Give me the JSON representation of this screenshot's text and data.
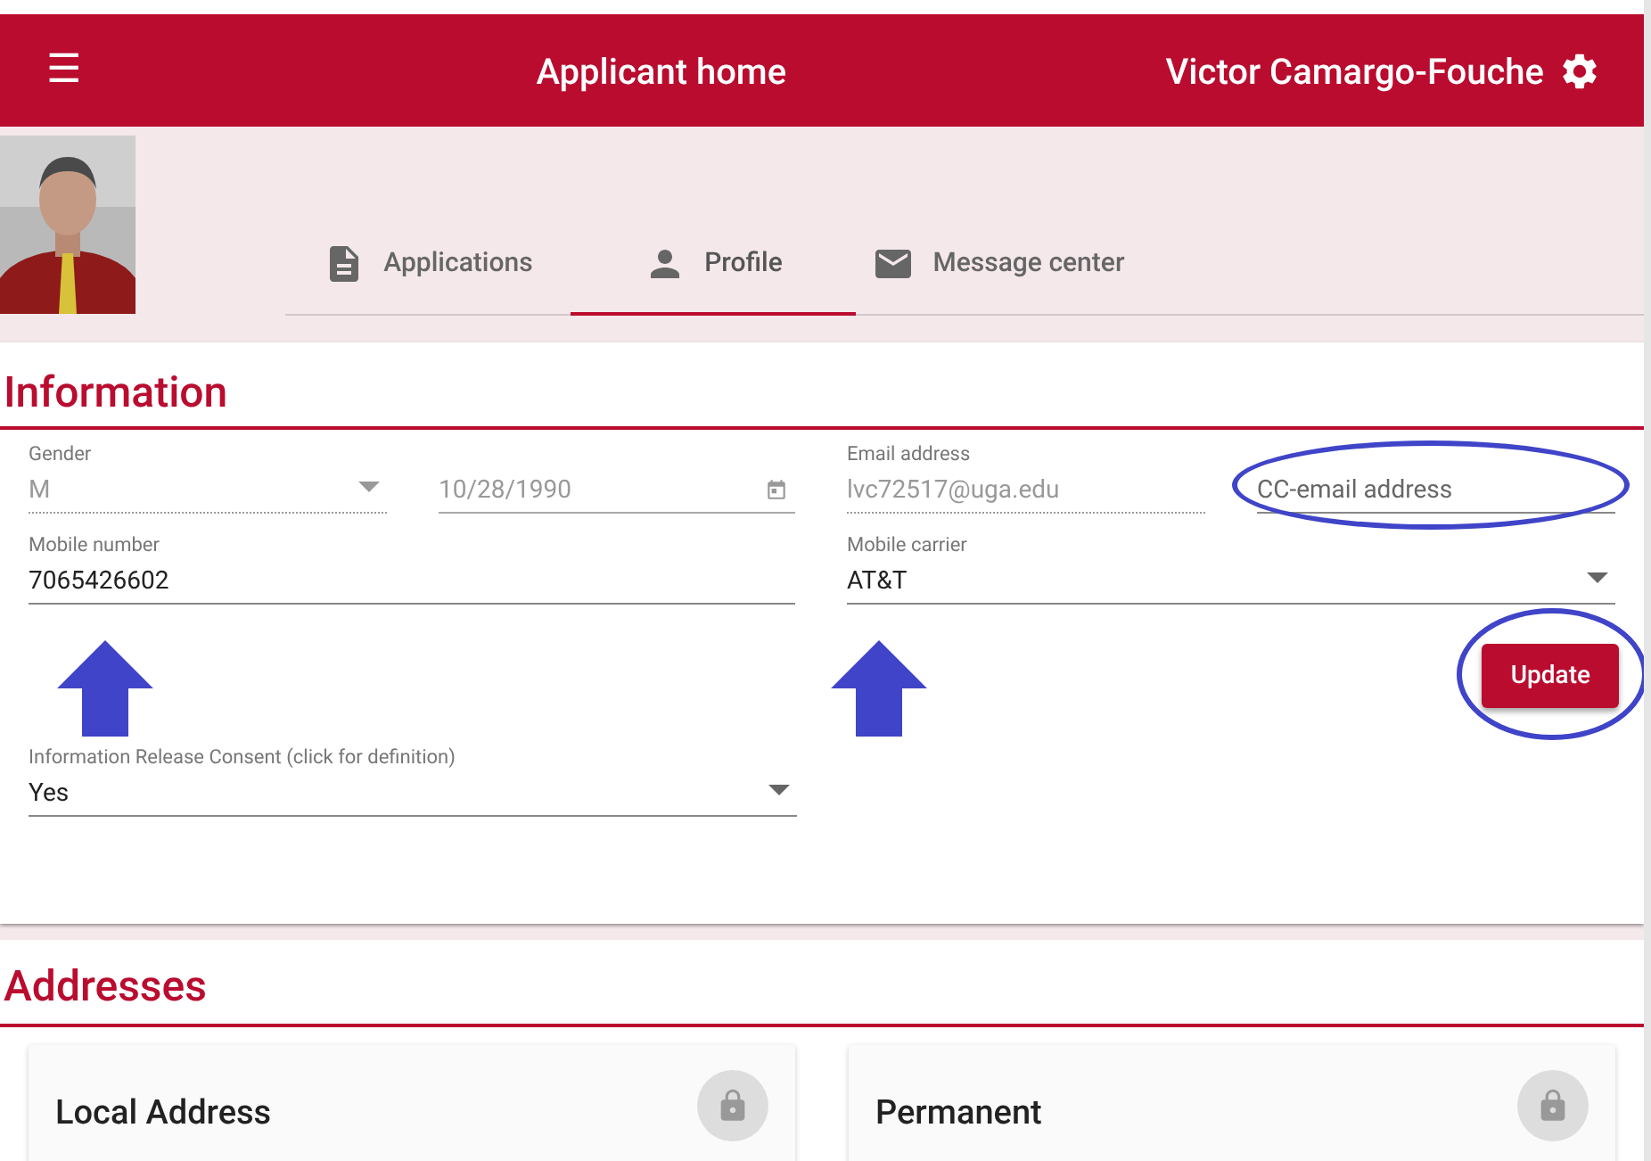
{
  "header": {
    "menu_icon": "☰",
    "title": "Applicant home",
    "user_name": "Victor Camargo-Fouche"
  },
  "tabs": [
    {
      "label": "Applications",
      "selected": false
    },
    {
      "label": "Profile",
      "selected": true
    },
    {
      "label": "Message center",
      "selected": false
    }
  ],
  "information": {
    "heading": "Information",
    "fields": [
      {
        "kind": "select",
        "label": "Gender",
        "value": "M",
        "disabled": true
      },
      {
        "kind": "date",
        "value": "10/28/1990",
        "disabled": true
      },
      {
        "kind": "text",
        "label": "Email address",
        "value": "lvc72517@uga.edu",
        "disabled": true
      },
      {
        "kind": "text",
        "placeholder": "CC-email address",
        "disabled": false,
        "circled": true
      },
      {
        "kind": "text",
        "label": "Mobile number",
        "value": "7065426602",
        "disabled": false,
        "pointed": true
      },
      {
        "kind": "select",
        "label": "Mobile carrier",
        "value": "AT&T",
        "disabled": false,
        "pointed": true
      }
    ],
    "update_button": {
      "label": "Update",
      "circled": true
    },
    "consent": {
      "kind": "select",
      "label": "Information Release Consent (click for definition)",
      "value": "Yes",
      "disabled": false
    }
  },
  "addresses": {
    "heading": "Addresses",
    "cards": [
      {
        "title": "Local Address",
        "locked": true
      },
      {
        "title": "Permanent",
        "locked": true
      }
    ]
  }
}
